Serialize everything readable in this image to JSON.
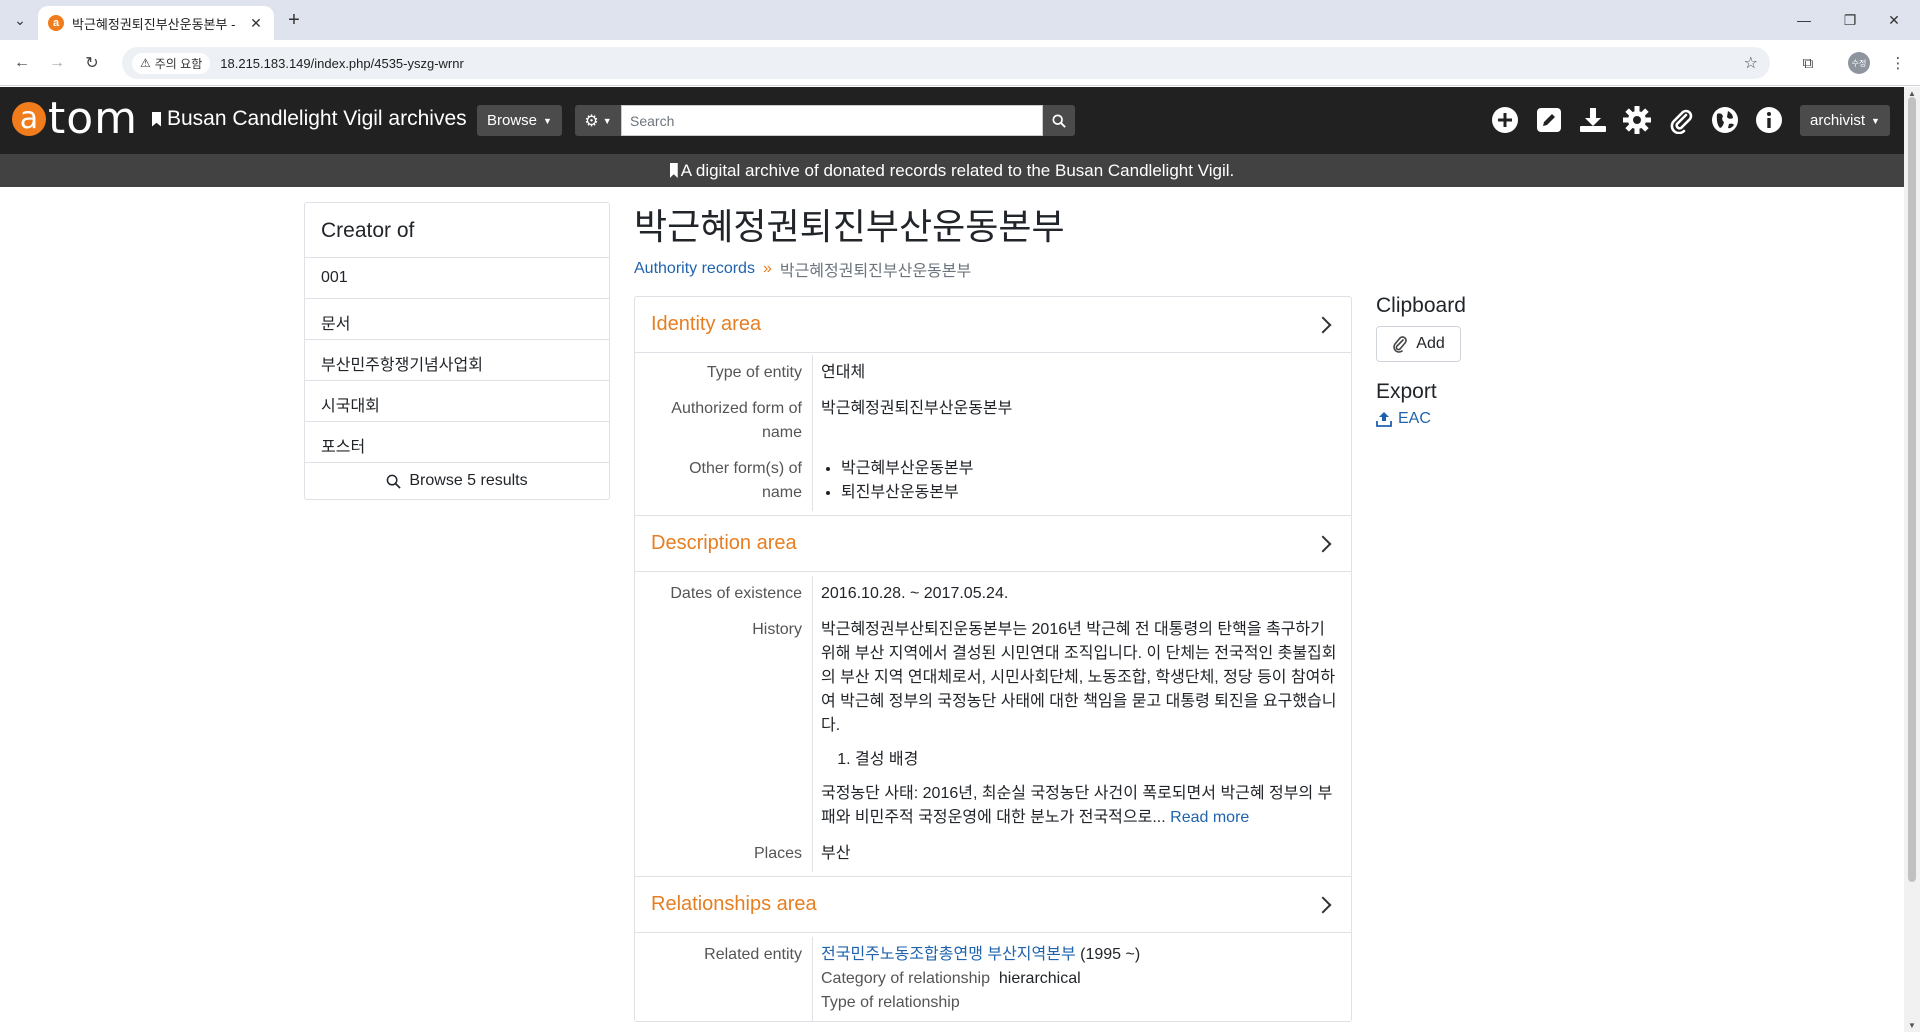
{
  "browser": {
    "tab_title": "박근혜정권퇴진부산운동본부 -",
    "tab_favicon": "a",
    "security_label": "주의 요함",
    "url": "18.215.183.149/index.php/4535-yszg-wrnr",
    "profile_label": "수정"
  },
  "header": {
    "logo_letter": "a",
    "logo_text": "tom",
    "site_name": "Busan Candlelight Vigil archives",
    "browse_label": "Browse",
    "search_placeholder": "Search",
    "user_label": "archivist",
    "description": "A digital archive of donated records related to the Busan Candlelight Vigil."
  },
  "sidebar": {
    "title": "Creator of",
    "items": [
      "001",
      "문서",
      "부산민주항쟁기념사업회",
      "시국대회",
      "포스터"
    ],
    "browse_label": "Browse 5 results"
  },
  "page": {
    "title": "박근혜정권퇴진부산운동본부",
    "breadcrumb_link": "Authority records",
    "breadcrumb_sep": "»",
    "breadcrumb_current": "박근혜정권퇴진부산운동본부"
  },
  "identity": {
    "heading": "Identity area",
    "type_label": "Type of entity",
    "type_value": "연대체",
    "auth_label": "Authorized form of name",
    "auth_value": "박근혜정권퇴진부산운동본부",
    "other_label": "Other form(s) of name",
    "other_values": [
      "박근혜부산운동본부",
      "퇴진부산운동본부"
    ]
  },
  "description": {
    "heading": "Description area",
    "dates_label": "Dates of existence",
    "dates_value": "2016.10.28. ~ 2017.05.24.",
    "history_label": "History",
    "history_p1": "박근혜정권부산퇴진운동본부는 2016년 박근혜 전 대통령의 탄핵을 촉구하기 위해 부산 지역에서 결성된 시민연대 조직입니다. 이 단체는 전국적인 촛불집회의 부산 지역 연대체로서, 시민사회단체, 노동조합, 학생단체, 정당 등이 참여하여 박근혜 정부의 국정농단 사태에 대한 책임을 묻고 대통령 퇴진을 요구했습니다.",
    "history_list_item": "결성 배경",
    "history_p2": "국정농단 사태: 2016년, 최순실 국정농단 사건이 폭로되면서 박근혜 정부의 부패와 비민주적 국정운영에 대한 분노가 전국적으로...",
    "read_more": "Read more",
    "places_label": "Places",
    "places_value": "부산"
  },
  "relationships": {
    "heading": "Relationships area",
    "related_label": "Related entity",
    "related_link": "전국민주노동조합총연맹 부산지역본부",
    "related_dates": "(1995 ~)",
    "category_label": "Category of relationship",
    "category_value": "hierarchical",
    "type_label": "Type of relationship"
  },
  "right": {
    "clipboard_title": "Clipboard",
    "add_label": "Add",
    "export_title": "Export",
    "eac_label": "EAC"
  },
  "colors": {
    "accent": "#e67e22",
    "link": "#1f63ad",
    "header_bg": "#212121",
    "desc_bg": "#424242"
  }
}
